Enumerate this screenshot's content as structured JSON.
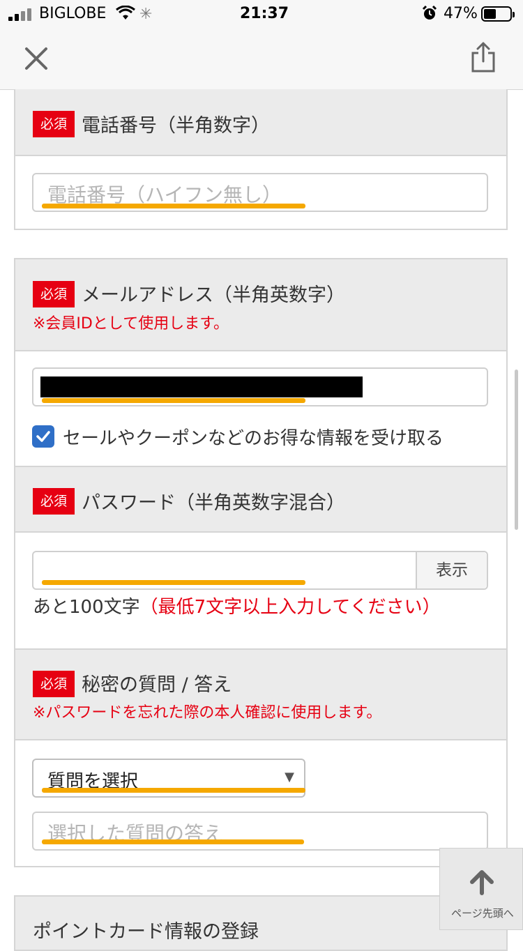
{
  "status_bar": {
    "carrier": "BIGLOBE",
    "time": "21:37",
    "battery": "47%"
  },
  "nav": {
    "close_icon": "close-icon",
    "share_icon": "share-icon"
  },
  "phone_section": {
    "badge": "必須",
    "label": "電話番号（半角数字）",
    "input_placeholder": "電話番号（ハイフン無し）"
  },
  "email_section": {
    "badge": "必須",
    "label": "メールアドレス（半角英数字）",
    "note": "※会員IDとして使用します。",
    "checkbox_label": "セールやクーポンなどのお得な情報を受け取る",
    "checkbox_checked": true
  },
  "password_section": {
    "badge": "必須",
    "label": "パスワード（半角英数字混合）",
    "show_button": "表示",
    "counter_text": "あと100文字",
    "counter_requirement": "（最低7文字以上入力してください）"
  },
  "secret_section": {
    "badge": "必須",
    "label": "秘密の質問 / 答え",
    "note": "※パスワードを忘れた際の本人確認に使用します。",
    "select_value": "質問を選択",
    "answer_placeholder": "選択した質問の答え"
  },
  "point_section": {
    "label": "ポイントカード情報の登録"
  },
  "back_to_top": {
    "label": "ページ先頭へ"
  },
  "colors": {
    "badge_red": "#e60012",
    "highlight_orange": "#f5a800",
    "checkbox_blue": "#2f6fc7"
  }
}
